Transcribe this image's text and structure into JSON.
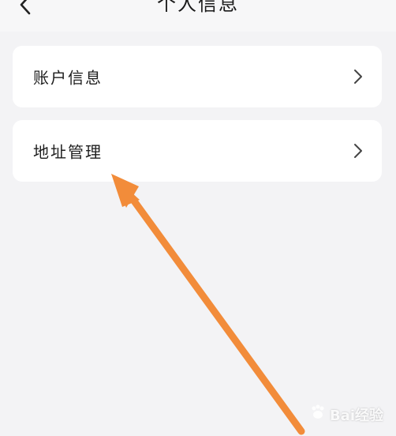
{
  "header": {
    "title": "个人信息"
  },
  "menu": {
    "items": [
      {
        "label": "账户信息"
      },
      {
        "label": "地址管理"
      }
    ]
  },
  "annotation": {
    "arrow_color": "#f28c3a"
  },
  "watermark": {
    "text": "Bai经验"
  },
  "colors": {
    "background": "#f3f3f5",
    "card": "#ffffff",
    "text": "#1d1d1d"
  }
}
